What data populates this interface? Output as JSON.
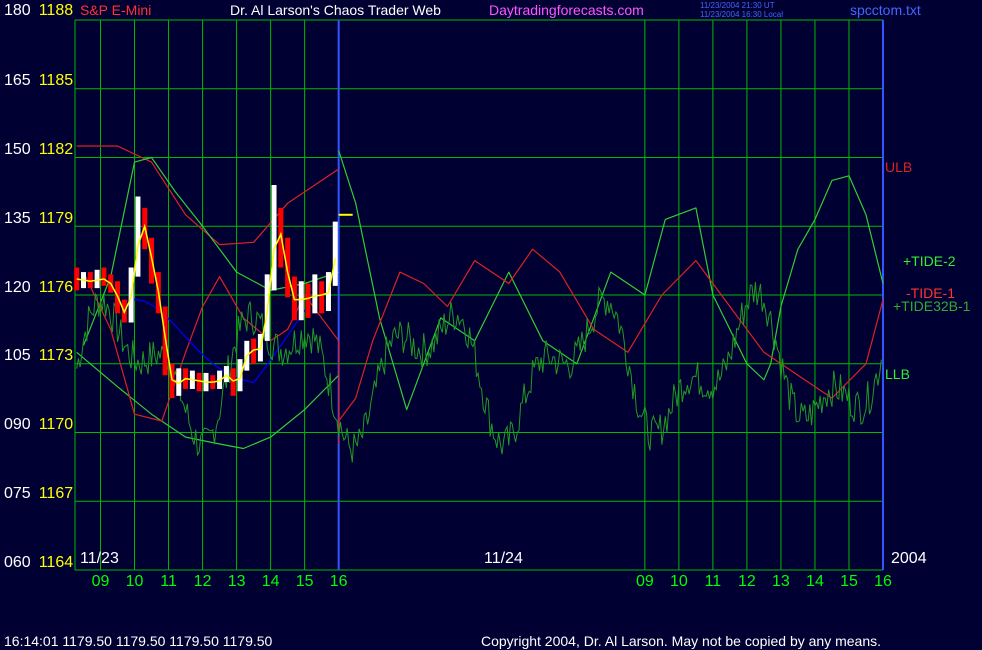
{
  "header": {
    "instrument": "S&P E-Mini",
    "site_title": "Dr. Al Larson's Chaos Trader Web",
    "site_url": "Daytradingforecasts.com",
    "timestamp_ut": "11/23/2004 21:30 UT",
    "timestamp_local": "11/23/2004 16:30 Local",
    "file_name": "spcctom.txt"
  },
  "footer": {
    "quote": "16:14:01  1179.50 1179.50 1179.50 1179.50",
    "copyright": "Copyright 2004, Dr. Al Larson. May not be copied by any means."
  },
  "colors": {
    "background": "#000033",
    "grid": "#00bb00",
    "price_up": "#ffffff",
    "price_down": "#ff0000",
    "average": "#ffff00",
    "tide_green": "#33cc33",
    "tide_red": "#dd2222",
    "tide32b": "#229922",
    "band": "#aa1111",
    "blue_curve": "#0000ff",
    "day_divider": "#3355ff"
  },
  "chart_data": {
    "type": "line",
    "title": "S&P E-Mini",
    "y_left_ticks": [
      "060",
      "075",
      "090",
      "105",
      "120",
      "135",
      "150",
      "165",
      "180"
    ],
    "y_right_ticks": [
      "1164",
      "1167",
      "1170",
      "1173",
      "1176",
      "1179",
      "1182",
      "1185",
      "1188"
    ],
    "ylim": [
      1164,
      1188
    ],
    "x_hours": [
      "09",
      "10",
      "11",
      "12",
      "13",
      "14",
      "15",
      "16",
      "09",
      "10",
      "11",
      "12",
      "13",
      "14",
      "15",
      "16"
    ],
    "x_hour_values": [
      9,
      10,
      11,
      12,
      13,
      14,
      15,
      16,
      25,
      26,
      27,
      28,
      29,
      30,
      31,
      32
    ],
    "xlim": [
      8.25,
      32
    ],
    "date_labels": [
      "11/23",
      "11/24"
    ],
    "year_label": "2004",
    "day_divider_x": 16,
    "legend": [
      "ULB",
      "+TIDE-2",
      "-TIDE-1",
      "+TIDE32B-1",
      "LLB"
    ],
    "price_bars": [
      {
        "t": 8.3,
        "o": 1176.8,
        "c": 1176.6,
        "h": 1177.2,
        "l": 1176.2
      },
      {
        "t": 8.5,
        "o": 1176.6,
        "c": 1176.7,
        "h": 1177.0,
        "l": 1176.3
      },
      {
        "t": 8.7,
        "o": 1176.7,
        "c": 1176.5,
        "h": 1177.0,
        "l": 1176.3
      },
      {
        "t": 8.9,
        "o": 1176.5,
        "c": 1176.8,
        "h": 1177.1,
        "l": 1176.3
      },
      {
        "t": 9.1,
        "o": 1176.8,
        "c": 1176.6,
        "h": 1177.2,
        "l": 1176.4
      },
      {
        "t": 9.3,
        "o": 1176.6,
        "c": 1176.4,
        "h": 1176.9,
        "l": 1176.1
      },
      {
        "t": 9.5,
        "o": 1176.4,
        "c": 1175.5,
        "h": 1176.6,
        "l": 1175.2
      },
      {
        "t": 9.7,
        "o": 1175.5,
        "c": 1175.0,
        "h": 1175.8,
        "l": 1174.8
      },
      {
        "t": 9.9,
        "o": 1175.0,
        "c": 1176.8,
        "h": 1177.2,
        "l": 1174.8
      },
      {
        "t": 10.1,
        "o": 1176.8,
        "c": 1179.5,
        "h": 1180.3,
        "l": 1176.8
      },
      {
        "t": 10.3,
        "o": 1179.5,
        "c": 1178.5,
        "h": 1179.8,
        "l": 1178.0
      },
      {
        "t": 10.5,
        "o": 1178.5,
        "c": 1176.8,
        "h": 1178.5,
        "l": 1176.5
      },
      {
        "t": 10.7,
        "o": 1176.8,
        "c": 1175.5,
        "h": 1177.0,
        "l": 1175.2
      },
      {
        "t": 10.9,
        "o": 1175.5,
        "c": 1172.8,
        "h": 1175.5,
        "l": 1172.5
      },
      {
        "t": 11.1,
        "o": 1172.8,
        "c": 1171.8,
        "h": 1173.0,
        "l": 1171.5
      },
      {
        "t": 11.3,
        "o": 1171.8,
        "c": 1172.5,
        "h": 1172.8,
        "l": 1171.6
      },
      {
        "t": 11.5,
        "o": 1172.5,
        "c": 1172.2,
        "h": 1172.8,
        "l": 1171.9
      },
      {
        "t": 11.7,
        "o": 1172.2,
        "c": 1172.4,
        "h": 1172.7,
        "l": 1171.9
      },
      {
        "t": 11.9,
        "o": 1172.4,
        "c": 1172.1,
        "h": 1172.6,
        "l": 1171.8
      },
      {
        "t": 12.1,
        "o": 1172.1,
        "c": 1172.3,
        "h": 1172.6,
        "l": 1171.8
      },
      {
        "t": 12.3,
        "o": 1172.3,
        "c": 1172.1,
        "h": 1172.5,
        "l": 1171.9
      },
      {
        "t": 12.5,
        "o": 1172.1,
        "c": 1172.4,
        "h": 1172.7,
        "l": 1171.9
      },
      {
        "t": 12.7,
        "o": 1172.4,
        "c": 1172.6,
        "h": 1172.9,
        "l": 1172.2
      },
      {
        "t": 12.9,
        "o": 1172.6,
        "c": 1171.9,
        "h": 1172.8,
        "l": 1171.6
      },
      {
        "t": 13.1,
        "o": 1171.9,
        "c": 1172.8,
        "h": 1173.2,
        "l": 1171.8
      },
      {
        "t": 13.3,
        "o": 1172.8,
        "c": 1173.9,
        "h": 1174.0,
        "l": 1172.7
      },
      {
        "t": 13.5,
        "o": 1173.9,
        "c": 1173.3,
        "h": 1174.1,
        "l": 1173.0
      },
      {
        "t": 13.7,
        "o": 1173.3,
        "c": 1174.0,
        "h": 1174.3,
        "l": 1173.1
      },
      {
        "t": 13.9,
        "o": 1174.0,
        "c": 1176.5,
        "h": 1176.9,
        "l": 1174.0
      },
      {
        "t": 14.1,
        "o": 1176.5,
        "c": 1179.5,
        "h": 1180.8,
        "l": 1176.2
      },
      {
        "t": 14.3,
        "o": 1179.5,
        "c": 1177.8,
        "h": 1179.8,
        "l": 1177.2
      },
      {
        "t": 14.5,
        "o": 1177.8,
        "c": 1176.2,
        "h": 1178.5,
        "l": 1175.9
      },
      {
        "t": 14.7,
        "o": 1176.2,
        "c": 1175.4,
        "h": 1176.8,
        "l": 1174.9
      },
      {
        "t": 14.9,
        "o": 1175.4,
        "c": 1176.2,
        "h": 1176.6,
        "l": 1174.9
      },
      {
        "t": 15.1,
        "o": 1176.2,
        "c": 1175.5,
        "h": 1176.5,
        "l": 1175.0
      },
      {
        "t": 15.3,
        "o": 1175.5,
        "c": 1176.4,
        "h": 1176.9,
        "l": 1175.2
      },
      {
        "t": 15.5,
        "o": 1176.4,
        "c": 1175.6,
        "h": 1176.6,
        "l": 1175.2
      },
      {
        "t": 15.7,
        "o": 1175.6,
        "c": 1176.6,
        "h": 1177.0,
        "l": 1175.3
      },
      {
        "t": 15.9,
        "o": 1176.6,
        "c": 1178.6,
        "h": 1179.2,
        "l": 1176.4
      }
    ],
    "series": [
      {
        "name": "ULB",
        "color": "#dd2222",
        "points": [
          [
            8.3,
            1182.5
          ],
          [
            9.5,
            1182.5
          ],
          [
            10.5,
            1181.8
          ],
          [
            11.5,
            1179.5
          ],
          [
            12.5,
            1178.2
          ],
          [
            13.5,
            1178.3
          ],
          [
            14.5,
            1180.0
          ],
          [
            15.5,
            1181.0
          ],
          [
            16,
            1181.5
          ]
        ]
      },
      {
        "name": "LLB",
        "color": "#33cc33",
        "points": [
          [
            8.3,
            1173.5
          ],
          [
            9.5,
            1172.0
          ],
          [
            10.5,
            1170.8
          ],
          [
            11.5,
            1169.8
          ],
          [
            12.5,
            1169.5
          ],
          [
            13.2,
            1169.3
          ],
          [
            14,
            1169.8
          ],
          [
            15,
            1171.0
          ],
          [
            16,
            1172.5
          ]
        ]
      },
      {
        "name": "band-upper-green",
        "color": "#33cc33",
        "points": [
          [
            8.5,
            1173.8
          ],
          [
            9.3,
            1176.8
          ],
          [
            10,
            1181.8
          ],
          [
            10.5,
            1182.0
          ],
          [
            11.2,
            1180.5
          ],
          [
            12,
            1179.0
          ],
          [
            13,
            1177.0
          ],
          [
            14,
            1176.2
          ],
          [
            15,
            1176.5
          ],
          [
            16,
            1177.0
          ]
        ]
      },
      {
        "name": "band-lower-red",
        "color": "#dd2222",
        "points": [
          [
            8.5,
            1177.0
          ],
          [
            9.3,
            1174.5
          ],
          [
            10,
            1170.8
          ],
          [
            10.8,
            1170.5
          ],
          [
            11.5,
            1173.5
          ],
          [
            12,
            1175.5
          ],
          [
            12.5,
            1176.8
          ],
          [
            13.2,
            1175.0
          ],
          [
            14,
            1174.0
          ],
          [
            14.5,
            1174.5
          ],
          [
            15,
            1176.0
          ],
          [
            16,
            1174.0
          ],
          [
            16,
            1169.5
          ]
        ]
      },
      {
        "name": "+TIDE-2",
        "color": "#33cc33",
        "points": [
          [
            16,
            1182.3
          ],
          [
            16.5,
            1180.0
          ],
          [
            17.2,
            1175.0
          ],
          [
            18,
            1171.0
          ],
          [
            19,
            1175.0
          ],
          [
            20,
            1174.0
          ],
          [
            21,
            1177.0
          ],
          [
            22,
            1174.0
          ],
          [
            23,
            1173.0
          ],
          [
            24,
            1177.0
          ],
          [
            25,
            1176.0
          ],
          [
            25.6,
            1179.3
          ],
          [
            26.5,
            1179.8
          ],
          [
            27,
            1176.0
          ],
          [
            28,
            1173.0
          ],
          [
            28.5,
            1172.3
          ],
          [
            28.7,
            1173.0
          ],
          [
            29,
            1175.5
          ],
          [
            29.5,
            1178.0
          ],
          [
            30,
            1179.3
          ],
          [
            30.5,
            1181.0
          ],
          [
            31,
            1181.2
          ],
          [
            31.5,
            1179.5
          ],
          [
            32,
            1176.5
          ]
        ]
      },
      {
        "name": "-TIDE-1",
        "color": "#dd2222",
        "points": [
          [
            16,
            1170.5
          ],
          [
            16.5,
            1171.5
          ],
          [
            17,
            1174.0
          ],
          [
            17.8,
            1177.0
          ],
          [
            18.5,
            1176.5
          ],
          [
            19.2,
            1175.5
          ],
          [
            20,
            1177.5
          ],
          [
            21,
            1176.5
          ],
          [
            21.7,
            1178.0
          ],
          [
            22.5,
            1177.0
          ],
          [
            23.5,
            1174.5
          ],
          [
            24.5,
            1173.5
          ],
          [
            25.5,
            1176.0
          ],
          [
            26.5,
            1177.5
          ],
          [
            27.5,
            1175.5
          ],
          [
            28.5,
            1173.5
          ],
          [
            29.5,
            1172.5
          ],
          [
            30.5,
            1171.5
          ],
          [
            31.5,
            1173.0
          ],
          [
            32,
            1175.8
          ]
        ]
      }
    ],
    "tide32b_series_name": "+TIDE32B-1",
    "current_price": 1179.5
  }
}
